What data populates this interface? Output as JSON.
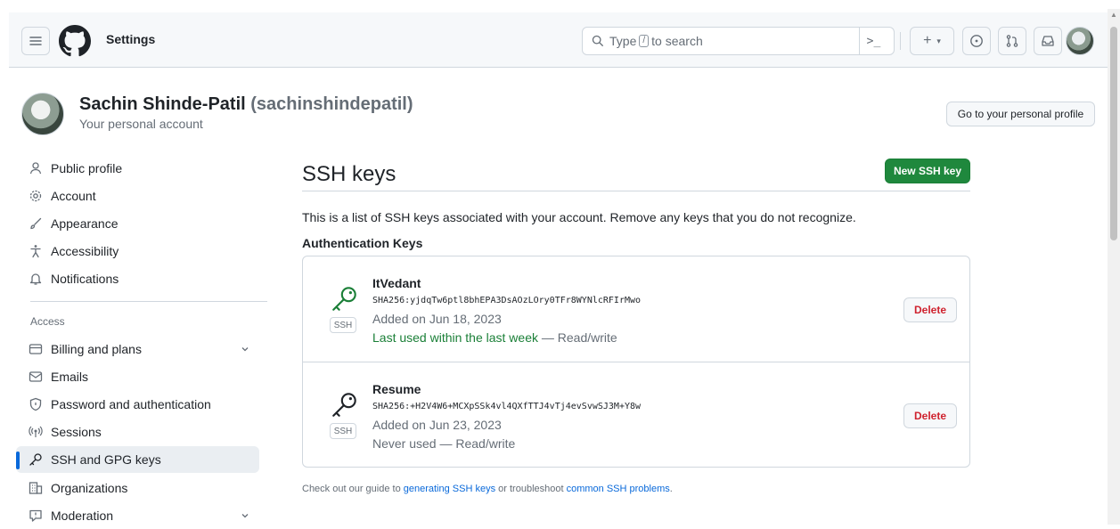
{
  "header": {
    "title": "Settings",
    "search_prefix": "Type",
    "search_key": "/",
    "search_suffix": "to search",
    "command_glyph": ">_",
    "icons": [
      "hamburger-icon",
      "github-logo-icon",
      "search-icon",
      "command-palette-icon",
      "plus-icon",
      "issues-icon",
      "pull-requests-icon",
      "inbox-icon"
    ]
  },
  "profile": {
    "name": "Sachin Shinde-Patil",
    "login": "(sachinshindepatil)",
    "subtitle": "Your personal account",
    "goto_label": "Go to your personal profile"
  },
  "sidebar": {
    "items": [
      {
        "label": "Public profile",
        "icon": "person-icon"
      },
      {
        "label": "Account",
        "icon": "gear-icon"
      },
      {
        "label": "Appearance",
        "icon": "paintbrush-icon"
      },
      {
        "label": "Accessibility",
        "icon": "accessibility-icon"
      },
      {
        "label": "Notifications",
        "icon": "bell-icon"
      }
    ],
    "access_heading": "Access",
    "access_items": [
      {
        "label": "Billing and plans",
        "icon": "credit-card-icon",
        "expandable": true
      },
      {
        "label": "Emails",
        "icon": "mail-icon"
      },
      {
        "label": "Password and authentication",
        "icon": "shield-lock-icon"
      },
      {
        "label": "Sessions",
        "icon": "broadcast-icon"
      },
      {
        "label": "SSH and GPG keys",
        "icon": "key-icon",
        "active": true
      },
      {
        "label": "Organizations",
        "icon": "organization-icon"
      },
      {
        "label": "Moderation",
        "icon": "report-icon",
        "expandable": true
      }
    ]
  },
  "main": {
    "title": "SSH keys",
    "new_key_label": "New SSH key",
    "description": "This is a list of SSH keys associated with your account. Remove any keys that you do not recognize.",
    "auth_heading": "Authentication Keys",
    "keys": [
      {
        "name": "ItVedant",
        "fingerprint": "SHA256:yjdqTw6ptl8bhEPA3DsAOzLOry0TFr8WYNlcRFIrMwo",
        "added": "Added on Jun 18, 2023",
        "used": "Last used within the last week",
        "access": "— Read/write",
        "recent": true,
        "badge": "SSH",
        "delete_label": "Delete",
        "icon_color": "#1a7f37"
      },
      {
        "name": "Resume",
        "fingerprint": "SHA256:+H2V4W6+MCXpSSk4vl4QXfTTJ4vTj4evSvwSJ3M+Y8w",
        "added": "Added on Jun 23, 2023",
        "used": "Never used",
        "access": "— Read/write",
        "recent": false,
        "badge": "SSH",
        "delete_label": "Delete",
        "icon_color": "#1f2328"
      }
    ],
    "footer": {
      "prefix": "Check out our guide to",
      "link1": "generating SSH keys",
      "middle": "or troubleshoot",
      "link2": "common SSH problems",
      "suffix": "."
    }
  },
  "colors": {
    "accent": "#0969da",
    "primary_button": "#1f883d",
    "danger": "#cf222e",
    "success": "#1a7f37"
  }
}
